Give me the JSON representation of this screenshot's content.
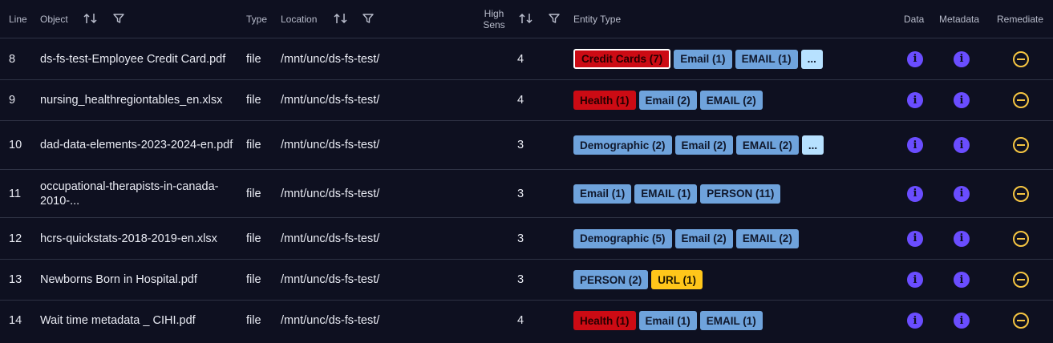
{
  "header": {
    "line": "Line",
    "object": "Object",
    "type": "Type",
    "location": "Location",
    "high_sens_1": "High",
    "high_sens_2": "Sens",
    "entity_type": "Entity Type",
    "data": "Data",
    "metadata": "Metadata",
    "remediate": "Remediate",
    "icons": {
      "sort": "sort-icon",
      "filter": "filter-icon"
    }
  },
  "colors": {
    "badge_blue": "#6fa3dc",
    "badge_red": "#cc0b14",
    "badge_yellow": "#ffc61a",
    "badge_more": "#b7e1ff",
    "info": "#6a4dff",
    "remediate": "#f5c542"
  },
  "rows": [
    {
      "line": "8",
      "object": "ds-fs-test-Employee Credit Card.pdf",
      "type": "file",
      "location": "/mnt/unc/ds-fs-test/",
      "high_sens": "4",
      "entities": [
        {
          "label": "Credit Cards (7)",
          "color": "redbox"
        },
        {
          "label": "Email (1)",
          "color": "blue"
        },
        {
          "label": "EMAIL (1)",
          "color": "blue"
        },
        {
          "label": "...",
          "color": "more"
        }
      ]
    },
    {
      "line": "9",
      "object": "nursing_healthregiontables_en.xlsx",
      "type": "file",
      "location": "/mnt/unc/ds-fs-test/",
      "high_sens": "4",
      "entities": [
        {
          "label": "Health (1)",
          "color": "red"
        },
        {
          "label": "Email (2)",
          "color": "blue"
        },
        {
          "label": "EMAIL (2)",
          "color": "blue"
        }
      ]
    },
    {
      "line": "10",
      "object": "dad-data-elements-2023-2024-en.pdf",
      "type": "file",
      "location": "/mnt/unc/ds-fs-test/",
      "high_sens": "3",
      "entities": [
        {
          "label": "Demographic (2)",
          "color": "blue"
        },
        {
          "label": "Email (2)",
          "color": "blue"
        },
        {
          "label": "EMAIL (2)",
          "color": "blue"
        },
        {
          "label": "...",
          "color": "more"
        }
      ]
    },
    {
      "line": "11",
      "object": "occupational-therapists-in-canada-2010-...",
      "type": "file",
      "location": "/mnt/unc/ds-fs-test/",
      "high_sens": "3",
      "entities": [
        {
          "label": "Email (1)",
          "color": "blue"
        },
        {
          "label": "EMAIL (1)",
          "color": "blue"
        },
        {
          "label": "PERSON (11)",
          "color": "blue"
        }
      ]
    },
    {
      "line": "12",
      "object": "hcrs-quickstats-2018-2019-en.xlsx",
      "type": "file",
      "location": "/mnt/unc/ds-fs-test/",
      "high_sens": "3",
      "entities": [
        {
          "label": "Demographic (5)",
          "color": "blue"
        },
        {
          "label": "Email (2)",
          "color": "blue"
        },
        {
          "label": "EMAIL (2)",
          "color": "blue"
        }
      ]
    },
    {
      "line": "13",
      "object": "Newborns Born in Hospital.pdf",
      "type": "file",
      "location": "/mnt/unc/ds-fs-test/",
      "high_sens": "3",
      "entities": [
        {
          "label": "PERSON (2)",
          "color": "blue"
        },
        {
          "label": "URL (1)",
          "color": "yellow"
        }
      ]
    },
    {
      "line": "14",
      "object": "Wait time metadata _ CIHI.pdf",
      "type": "file",
      "location": "/mnt/unc/ds-fs-test/",
      "high_sens": "4",
      "entities": [
        {
          "label": "Health (1)",
          "color": "red"
        },
        {
          "label": "Email (1)",
          "color": "blue"
        },
        {
          "label": "EMAIL (1)",
          "color": "blue"
        }
      ]
    }
  ]
}
